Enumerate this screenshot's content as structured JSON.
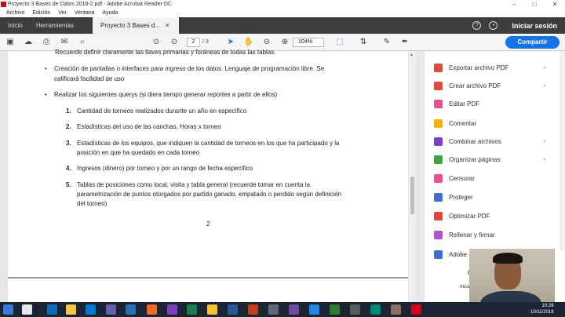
{
  "window": {
    "title": "Proyecto 3 Bases de Datos 2018-2.pdf - Adobe Acrobat Reader DC",
    "controls": [
      "–",
      "□",
      "✕"
    ]
  },
  "menu": [
    "Archivo",
    "Edición",
    "Ver",
    "Ventana",
    "Ayuda"
  ],
  "tabs": {
    "home": "Inicio",
    "tools": "Herramientas",
    "document": "Proyecto 3 Bases d...",
    "close": "✕",
    "signin": "Iniciar sesión"
  },
  "toolbar": {
    "page_current": "2",
    "page_total": "/ 3",
    "zoom": "104%",
    "share": "Compartir"
  },
  "document": {
    "top_line": "Recuerde definir claramente las llaves primarias y foráneas de todas las tablas.",
    "bullet1_line1": "Creación de pantallas o interfaces para ingreso de los datos. Lenguaje de programación libre. Se",
    "bullet1_line2": "calificará facilidad de uso",
    "bullet2": "Realizar los siguientes querys (si diera tiempo generar reportes a partir de ellos)",
    "items": [
      {
        "num": "1.",
        "lines": [
          "Cantidad de torneos realizados durante un año en específico"
        ]
      },
      {
        "num": "2.",
        "lines": [
          "Estadísticas del uso de las canchas, Horas x torneo"
        ]
      },
      {
        "num": "3.",
        "lines": [
          "Estadísticas de los equipos, que indiquen la cantidad de torneos en los que ha participado y la",
          "posición en que ha quedado en cada torneo"
        ]
      },
      {
        "num": "4.",
        "lines": [
          "Ingresos (dinero) por torneo y por un rango de fecha específico"
        ]
      },
      {
        "num": "5.",
        "lines": [
          "Tablas de posiciones como local, visita y tabla general (recuerde tomar en cuenta la",
          "parametrización de puntos otorgados por partido ganado, empatado o perdido según definición",
          "del torneo)"
        ]
      }
    ],
    "page_number": "2"
  },
  "tools_panel": [
    {
      "label": "Exportar archivo PDF",
      "color": "#e0483b",
      "chevron": true
    },
    {
      "label": "Crear archivo PDF",
      "color": "#e0483b",
      "chevron": true
    },
    {
      "label": "Editar PDF",
      "color": "#e8508f",
      "chevron": false
    },
    {
      "label": "Comentar",
      "color": "#f0b400",
      "chevron": false
    },
    {
      "label": "Combinar archivos",
      "color": "#7b3fd1",
      "chevron": true
    },
    {
      "label": "Organizar páginas",
      "color": "#3ea33f",
      "chevron": true
    },
    {
      "label": "Censurar",
      "color": "#e8508f",
      "chevron": false
    },
    {
      "label": "Proteger",
      "color": "#3f6ed1",
      "chevron": false
    },
    {
      "label": "Optimizar PDF",
      "color": "#e0483b",
      "chevron": false
    },
    {
      "label": "Rellenar y firmar",
      "color": "#b04fd1",
      "chevron": false
    },
    {
      "label": "Adobe",
      "color": "#3f6ed1",
      "chevron": false
    }
  ],
  "panel_fragments": {
    "c": "C",
    "inic": "Inicia"
  },
  "taskbar": {
    "time": "10:26",
    "date": "10/11/2018"
  }
}
